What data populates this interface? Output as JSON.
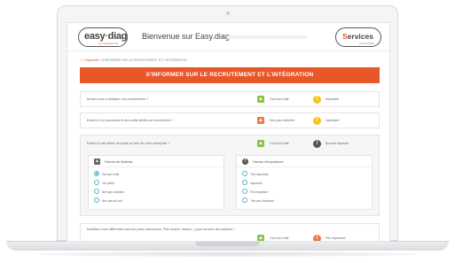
{
  "header": {
    "logo_text": "easy",
    "logo_dot": "·",
    "logo_text2": "diag",
    "logo_sub": "by Franchise Me",
    "welcome": "Bienvenue sur Easy.diag",
    "services_first": "S",
    "services_rest": "ervices",
    "services_sub": "FranchiseMe"
  },
  "breadcrumb": {
    "home": "⌂",
    "sep1": " › ",
    "diagnostic": "Diagnostic",
    "sep2": " › ",
    "current": "S'INFORMER SUR LE RECRUTEMENT ET L'INTÉGRATION"
  },
  "banner": {
    "title": "S'INFORMER SUR LE RECRUTEMENT ET L'INTÉGRATION"
  },
  "questions": [
    {
      "text": "Arrivez-vous à anticiper vos recrutements ?",
      "answer": "Oui tout à fait",
      "answer_glyph": "▲",
      "importance": "Important",
      "importance_glyph": "!"
    },
    {
      "text": "Existe-t-il un processus et des outils dédiés au recrutement ?",
      "answer": "Non pas vraiment",
      "answer_glyph": "▲",
      "importance": "Important",
      "importance_glyph": "!"
    },
    {
      "text": "Existe-t-il des fiches de poste au sein de votre entreprise ?",
      "answer": "Oui tout à fait",
      "answer_glyph": "▲",
      "importance": "Aucune réponse",
      "importance_glyph": "!"
    },
    {
      "text": "Mobilisez-vous différentes sources (sites d'annonces, Pôle emploi, réseau...) pour recruter des salariés ?",
      "answer": "Oui tout à fait",
      "answer_glyph": "▲",
      "importance": "Peu important",
      "importance_glyph": "!"
    }
  ],
  "mastery": {
    "title": "Niveau de Maîtrise",
    "icon_glyph": "▲",
    "options": [
      "Oui tout à fait",
      "Oui plutôt",
      "Non pas vraiment",
      "Non pas du tout"
    ],
    "selected_index": 0
  },
  "importance": {
    "title": "Niveau d'importance",
    "icon_glyph": "!",
    "options": [
      "Très important",
      "Important",
      "Peu important",
      "Très peu important"
    ],
    "selected_index": -1
  }
}
